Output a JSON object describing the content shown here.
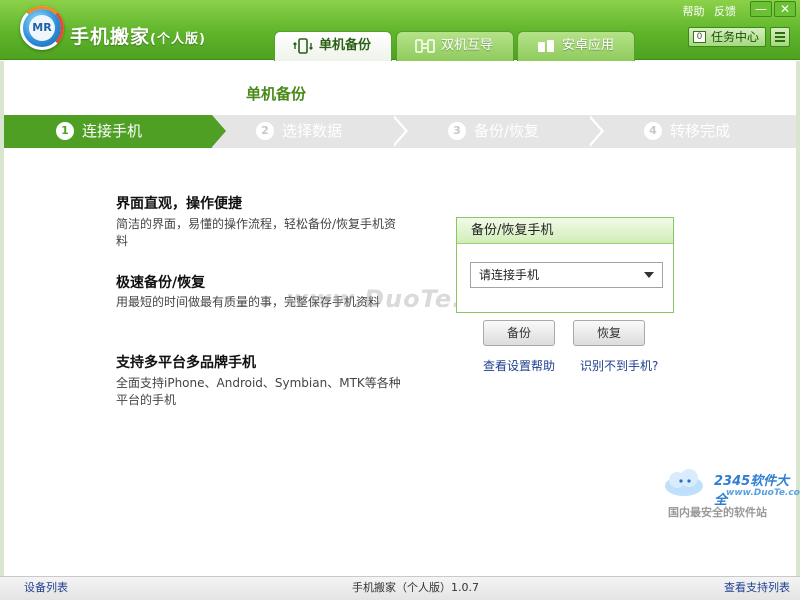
{
  "header": {
    "logo_text": "MR",
    "app_name": "手机搬家",
    "edition": "(个人版)",
    "links": [
      "帮助",
      "反馈"
    ],
    "minimize": "—",
    "close": "✕",
    "task_center_label": "任务中心",
    "task_center_count": "0"
  },
  "tabs": [
    {
      "label": "单机备份",
      "icon": "phone-backup-icon",
      "active": true
    },
    {
      "label": "双机互导",
      "icon": "dual-phone-icon",
      "active": false
    },
    {
      "label": "安卓应用",
      "icon": "android-icon",
      "active": false
    }
  ],
  "main": {
    "heading": "单机备份",
    "steps": [
      {
        "num": "1",
        "label": "连接手机",
        "active": true
      },
      {
        "num": "2",
        "label": "选择数据",
        "active": false
      },
      {
        "num": "3",
        "label": "备份/恢复",
        "active": false
      },
      {
        "num": "4",
        "label": "转移完成",
        "active": false
      }
    ],
    "features": [
      {
        "title": "界面直观，操作便捷",
        "desc": "简洁的界面，易懂的操作流程，轻松备份/恢复手机资料"
      },
      {
        "title": "极速备份/恢复",
        "desc": "用最短的时间做最有质量的事，完整保存手机资料"
      },
      {
        "title": "支持多平台多品牌手机",
        "desc": "全面支持iPhone、Android、Symbian、MTK等各种平台的手机"
      }
    ],
    "panel": {
      "title": "备份/恢复手机",
      "select_value": "请连接手机",
      "backup_button": "备份",
      "restore_button": "恢复",
      "help_link": "查看设置帮助",
      "not_found_link": "识别不到手机?"
    },
    "watermark": "www.DuoTe.com"
  },
  "corner_brand": {
    "brand": "2345软件大全",
    "site": "www.DuoTe.com",
    "slogan": "国内最安全的软件站"
  },
  "footer": {
    "device_list": "设备列表",
    "version": "手机搬家（个人版）1.0.7",
    "support_list": "查看支持列表"
  }
}
